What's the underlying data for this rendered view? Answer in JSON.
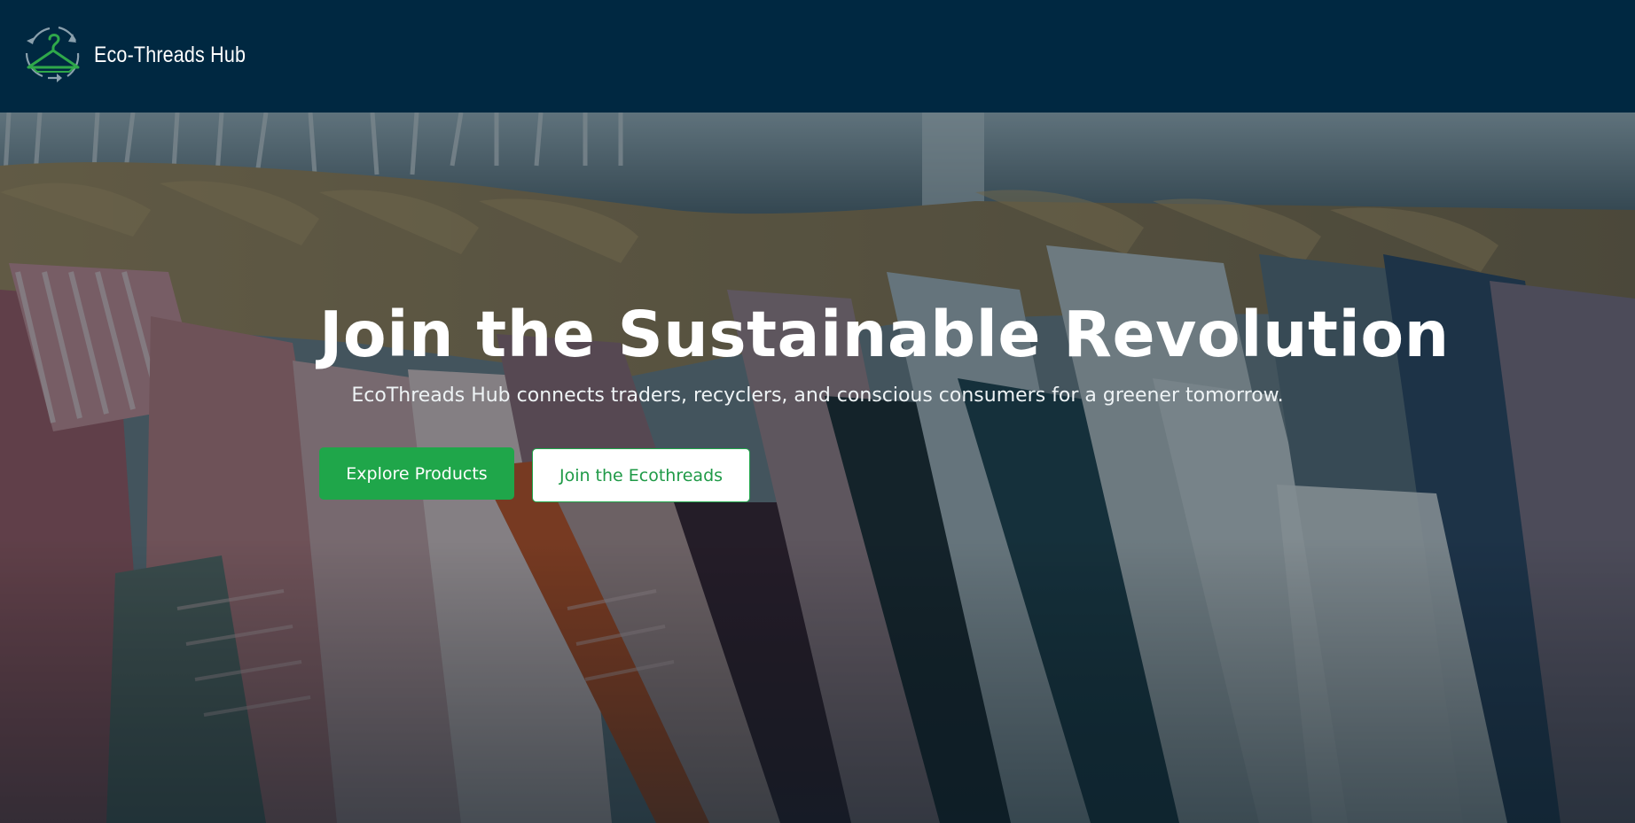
{
  "brand": {
    "name": "Eco-Threads Hub",
    "logo_icon": "recycle-hanger-icon",
    "colors": {
      "logo_green": "#2fa84a",
      "logo_grey": "#8aa0ad"
    }
  },
  "navbar": {
    "background": "#002841"
  },
  "hero": {
    "background_icon": "clothing-rack-photo",
    "title": "Join the Sustainable Revolution",
    "subtitle": "EcoThreads Hub connects traders, recyclers, and conscious consumers for a greener tomorrow.",
    "primary_button": "Explore Products",
    "secondary_button": "Join the Ecothreads"
  },
  "colors": {
    "accent": "#1fa64a",
    "text_on_dark": "#ffffff"
  }
}
